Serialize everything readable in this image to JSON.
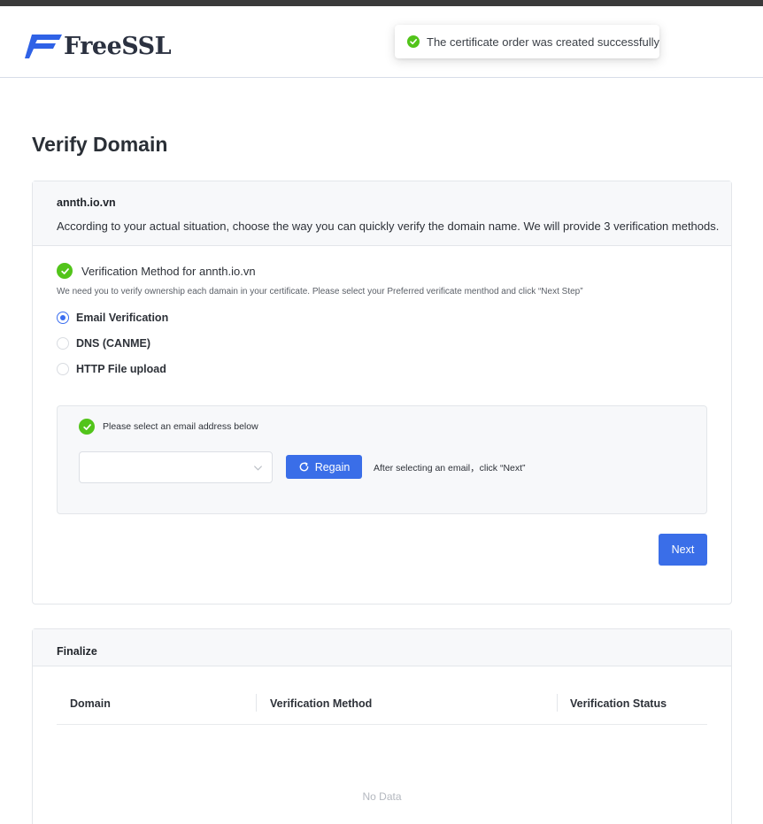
{
  "header": {
    "logo_text": "FreeSSL",
    "brand_color": "#2f62e6"
  },
  "toast": {
    "icon": "check-circle-icon",
    "message": "The certificate order was created successfully",
    "status_color": "#52c41a"
  },
  "page": {
    "title": "Verify Domain"
  },
  "verify_card": {
    "domain": "annth.io.vn",
    "description": "According to your actual situation, choose the way you can quickly verify the domain name. We will provide 3 verification methods.",
    "method_title": "Verification Method for annth.io.vn",
    "method_note": "We need you to verify ownership each damain in your certificate. Please select your Preferred verificate menthod and click “Next Step”",
    "methods": [
      {
        "label": "Email Verification",
        "selected": true
      },
      {
        "label": "DNS (CANME)",
        "selected": false
      },
      {
        "label": "HTTP File upload",
        "selected": false
      }
    ],
    "email_panel": {
      "title": "Please select an email address below",
      "select_value": "",
      "regain_label": "Regain",
      "hint": "After selecting an email，click “Next”"
    },
    "next_label": "Next"
  },
  "finalize_card": {
    "title": "Finalize",
    "columns": [
      "Domain",
      "Verification Method",
      "Verification Status"
    ],
    "empty_text": "No Data"
  },
  "colors": {
    "primary_button": "#3a6ee8",
    "success": "#52c41a"
  }
}
